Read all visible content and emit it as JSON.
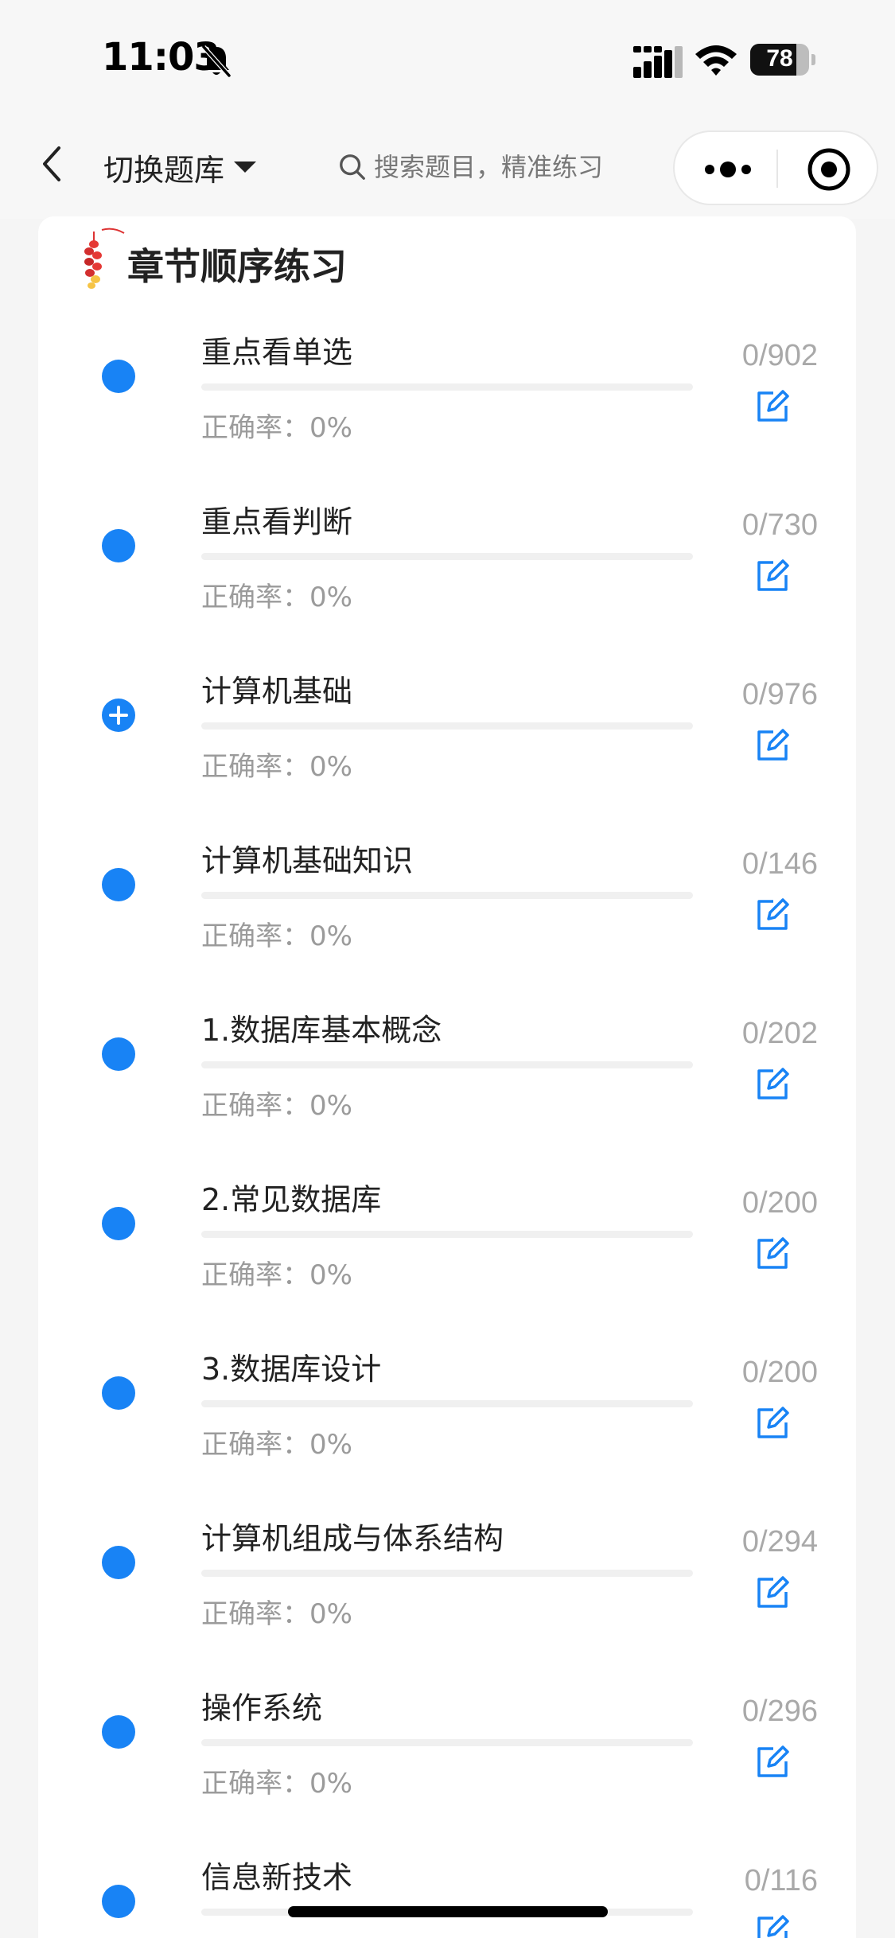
{
  "status_bar": {
    "time": "11:03",
    "battery": "78",
    "battery_level": 0.78
  },
  "nav": {
    "switch_label": "切换题库",
    "search_placeholder": "搜索题目，精准练习"
  },
  "section": {
    "title": "章节顺序练习"
  },
  "colors": {
    "accent": "#1883f5",
    "muted": "#9b9b9b",
    "count": "#a9a9a9"
  },
  "chapters": [
    {
      "title": "重点看单选",
      "accuracy": "正确率：0%",
      "count": "0/902",
      "progress": 0,
      "icon": "dot"
    },
    {
      "title": "重点看判断",
      "accuracy": "正确率：0%",
      "count": "0/730",
      "progress": 0,
      "icon": "dot"
    },
    {
      "title": "计算机基础",
      "accuracy": "正确率：0%",
      "count": "0/976",
      "progress": 0,
      "icon": "plus"
    },
    {
      "title": "计算机基础知识",
      "accuracy": "正确率：0%",
      "count": "0/146",
      "progress": 0,
      "icon": "dot"
    },
    {
      "title": "1.数据库基本概念",
      "accuracy": "正确率：0%",
      "count": "0/202",
      "progress": 0,
      "icon": "dot"
    },
    {
      "title": "2.常见数据库",
      "accuracy": "正确率：0%",
      "count": "0/200",
      "progress": 0,
      "icon": "dot"
    },
    {
      "title": "3.数据库设计",
      "accuracy": "正确率：0%",
      "count": "0/200",
      "progress": 0,
      "icon": "dot"
    },
    {
      "title": "计算机组成与体系结构",
      "accuracy": "正确率：0%",
      "count": "0/294",
      "progress": 0,
      "icon": "dot"
    },
    {
      "title": "操作系统",
      "accuracy": "正确率：0%",
      "count": "0/296",
      "progress": 0,
      "icon": "dot"
    },
    {
      "title": "信息新技术",
      "accuracy": "",
      "count": "0/116",
      "progress": 0,
      "icon": "dot"
    }
  ]
}
